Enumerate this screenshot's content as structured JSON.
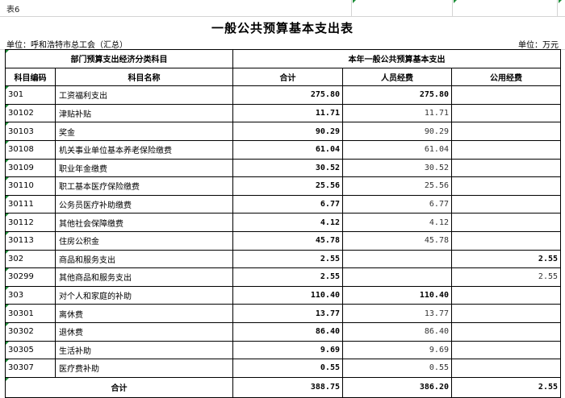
{
  "sheet_tag": "表6",
  "title": "一般公共预算基本支出表",
  "unit_left": "单位：呼和浩特市总工会（汇总）",
  "unit_right": "单位：万元",
  "header": {
    "group_left": "部门预算支出经济分类科目",
    "group_right": "本年一般公共预算基本支出",
    "col_code": "科目编码",
    "col_name": "科目名称",
    "col_total": "合计",
    "col_personnel": "人员经费",
    "col_public": "公用经费"
  },
  "rows": [
    {
      "code": "301",
      "name": "工资福利支出",
      "total": "275.80",
      "personnel": "275.80",
      "public": "",
      "level": 1
    },
    {
      "code": "30102",
      "name": "津贴补贴",
      "total": "11.71",
      "personnel": "11.71",
      "public": "",
      "level": 2
    },
    {
      "code": "30103",
      "name": "奖金",
      "total": "90.29",
      "personnel": "90.29",
      "public": "",
      "level": 2
    },
    {
      "code": "30108",
      "name": "机关事业单位基本养老保险缴费",
      "total": "61.04",
      "personnel": "61.04",
      "public": "",
      "level": 2
    },
    {
      "code": "30109",
      "name": "职业年金缴费",
      "total": "30.52",
      "personnel": "30.52",
      "public": "",
      "level": 2
    },
    {
      "code": "30110",
      "name": "职工基本医疗保险缴费",
      "total": "25.56",
      "personnel": "25.56",
      "public": "",
      "level": 2
    },
    {
      "code": "30111",
      "name": "公务员医疗补助缴费",
      "total": "6.77",
      "personnel": "6.77",
      "public": "",
      "level": 2
    },
    {
      "code": "30112",
      "name": "其他社会保障缴费",
      "total": "4.12",
      "personnel": "4.12",
      "public": "",
      "level": 2
    },
    {
      "code": "30113",
      "name": "住房公积金",
      "total": "45.78",
      "personnel": "45.78",
      "public": "",
      "level": 2
    },
    {
      "code": "302",
      "name": "商品和服务支出",
      "total": "2.55",
      "personnel": "",
      "public": "2.55",
      "level": 1
    },
    {
      "code": "30299",
      "name": "其他商品和服务支出",
      "total": "2.55",
      "personnel": "",
      "public": "2.55",
      "level": 2
    },
    {
      "code": "303",
      "name": "对个人和家庭的补助",
      "total": "110.40",
      "personnel": "110.40",
      "public": "",
      "level": 1
    },
    {
      "code": "30301",
      "name": "离休费",
      "total": "13.77",
      "personnel": "13.77",
      "public": "",
      "level": 2
    },
    {
      "code": "30302",
      "name": "退休费",
      "total": "86.40",
      "personnel": "86.40",
      "public": "",
      "level": 2
    },
    {
      "code": "30305",
      "name": "生活补助",
      "total": "9.69",
      "personnel": "9.69",
      "public": "",
      "level": 2
    },
    {
      "code": "30307",
      "name": "医疗费补助",
      "total": "0.55",
      "personnel": "0.55",
      "public": "",
      "level": 2
    }
  ],
  "totals": {
    "label": "合计",
    "total": "388.75",
    "personnel": "386.20",
    "public": "2.55"
  }
}
